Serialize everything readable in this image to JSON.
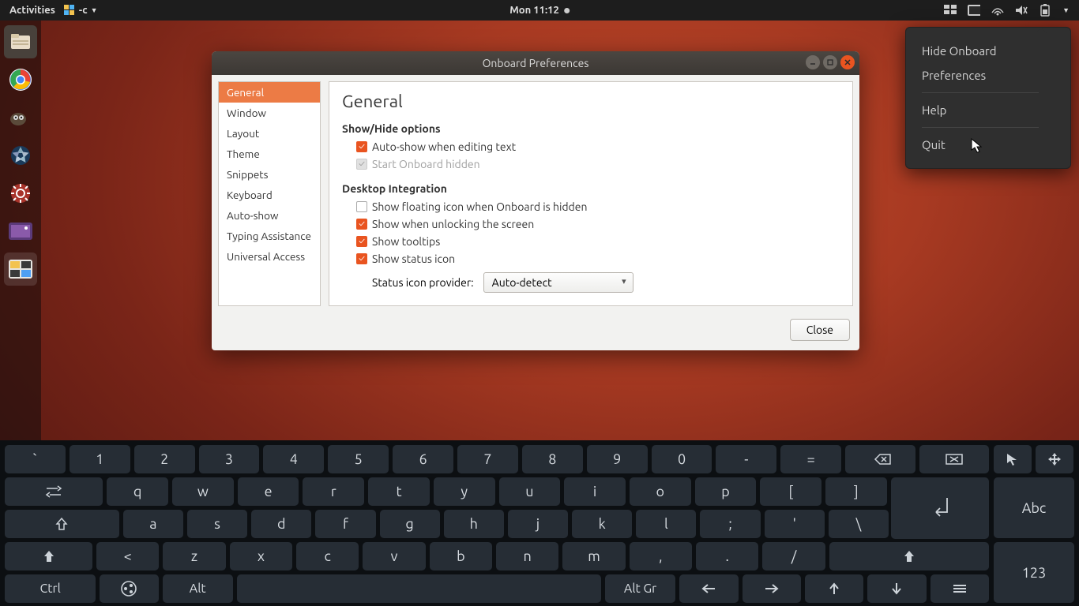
{
  "topbar": {
    "activities": "Activities",
    "appmenu": "-c",
    "clock": "Mon 11:12"
  },
  "popover": {
    "hide": "Hide Onboard",
    "prefs": "Preferences",
    "help": "Help",
    "quit": "Quit"
  },
  "dialog": {
    "title": "Onboard Preferences",
    "sidebar": [
      "General",
      "Window",
      "Layout",
      "Theme",
      "Snippets",
      "Keyboard",
      "Auto-show",
      "Typing Assistance",
      "Universal Access"
    ],
    "heading": "General",
    "section1": "Show/Hide options",
    "opt_autoshow": "Auto-show when editing text",
    "opt_starthidden": "Start Onboard hidden",
    "section2": "Desktop Integration",
    "opt_floating": "Show floating icon when Onboard is hidden",
    "opt_unlock": "Show when unlocking the screen",
    "opt_tooltips": "Show tooltips",
    "opt_status": "Show status icon",
    "status_label": "Status icon provider:",
    "status_value": "Auto-detect",
    "close": "Close"
  },
  "osk": {
    "row1": [
      "`",
      "1",
      "2",
      "3",
      "4",
      "5",
      "6",
      "7",
      "8",
      "9",
      "0",
      "-",
      "="
    ],
    "row2": [
      "q",
      "w",
      "e",
      "r",
      "t",
      "y",
      "u",
      "i",
      "o",
      "p",
      "[",
      "]"
    ],
    "row3": [
      "a",
      "s",
      "d",
      "f",
      "g",
      "h",
      "j",
      "k",
      "l",
      ";",
      "'",
      "\\"
    ],
    "row4": [
      "<",
      "z",
      "x",
      "c",
      "v",
      "b",
      "n",
      "m",
      ",",
      ".",
      "/"
    ],
    "row5": {
      "ctrl": "Ctrl",
      "alt": "Alt",
      "altgr": "Alt Gr"
    },
    "side": {
      "abc": "Abc",
      "num": "123"
    }
  }
}
